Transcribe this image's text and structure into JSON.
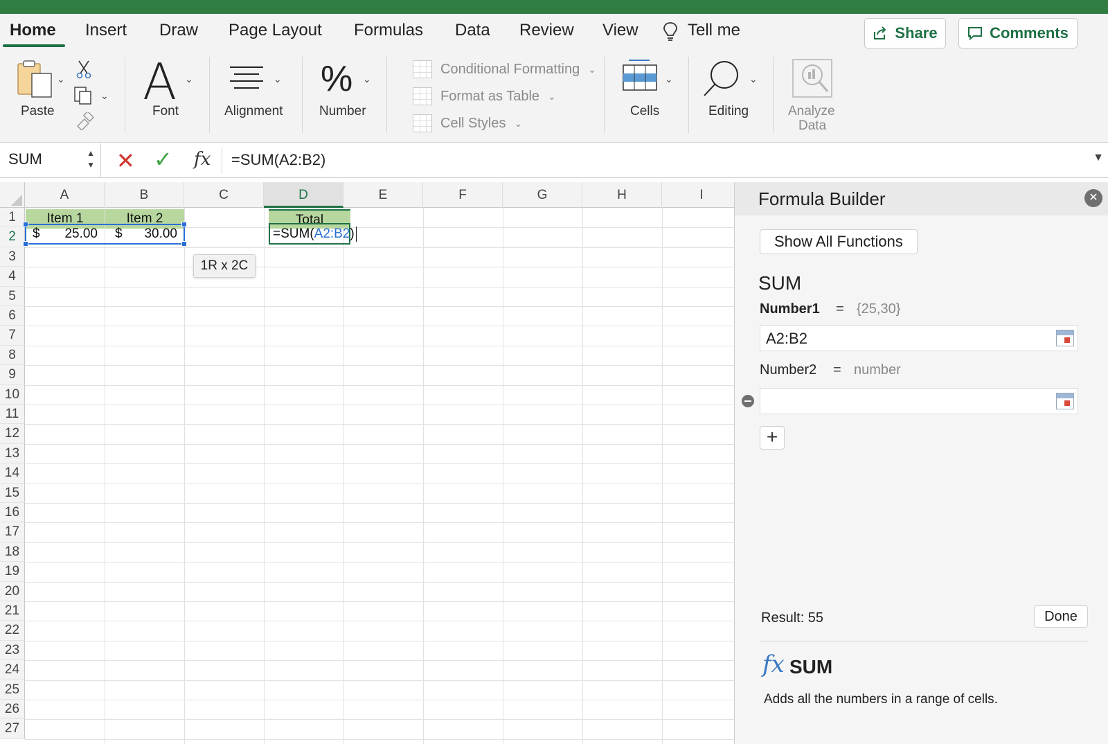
{
  "ribbon_tabs": [
    "Home",
    "Insert",
    "Draw",
    "Page Layout",
    "Formulas",
    "Data",
    "Review",
    "View"
  ],
  "tell_me": "Tell me",
  "share_label": "Share",
  "comments_label": "Comments",
  "ribbon": {
    "paste": "Paste",
    "font": "Font",
    "font_glyph": "A",
    "alignment": "Alignment",
    "number": "Number",
    "number_glyph": "%",
    "conditional_formatting": "Conditional Formatting",
    "format_as_table": "Format as Table",
    "cell_styles": "Cell Styles",
    "cells": "Cells",
    "editing": "Editing",
    "analyze_data_line1": "Analyze",
    "analyze_data_line2": "Data"
  },
  "formula_bar": {
    "name_box": "SUM",
    "formula": "=SUM(A2:B2)",
    "fx": "fx"
  },
  "grid": {
    "columns": [
      "A",
      "B",
      "C",
      "D",
      "E",
      "F",
      "G",
      "H",
      "I"
    ],
    "rows": [
      "1",
      "2",
      "3",
      "4",
      "5",
      "6",
      "7",
      "8",
      "9",
      "10",
      "11",
      "12",
      "13",
      "14",
      "15",
      "16",
      "17",
      "18",
      "19",
      "20",
      "21",
      "22",
      "23",
      "24",
      "25",
      "26",
      "27"
    ],
    "a1": "Item 1",
    "b1": "Item 2",
    "d1": "Total",
    "currency": "$",
    "a2_value": "25.00",
    "b2_value": "30.00",
    "d2_prefix": "=SUM(",
    "d2_ref": "A2:B2",
    "d2_suffix": ")",
    "tooltip": "1R x 2C"
  },
  "formula_builder": {
    "title": "Formula Builder",
    "show_all": "Show All Functions",
    "function_name": "SUM",
    "number1_label": "Number1",
    "equals": "=",
    "number1_value": "{25,30}",
    "number1_input": "A2:B2",
    "number2_label": "Number2",
    "number2_value": "number",
    "number2_input": "",
    "plus": "+",
    "result": "Result: 55",
    "done": "Done",
    "help_fx": "fx",
    "help_name": "SUM",
    "help_desc": "Adds all the numbers in a range of cells."
  },
  "colors": {
    "excel_green": "#1e7145",
    "header_fill": "#b7d79f",
    "selection_blue": "#2a6fd6",
    "cancel_red": "#d0342c",
    "enter_green": "#3fa344"
  }
}
